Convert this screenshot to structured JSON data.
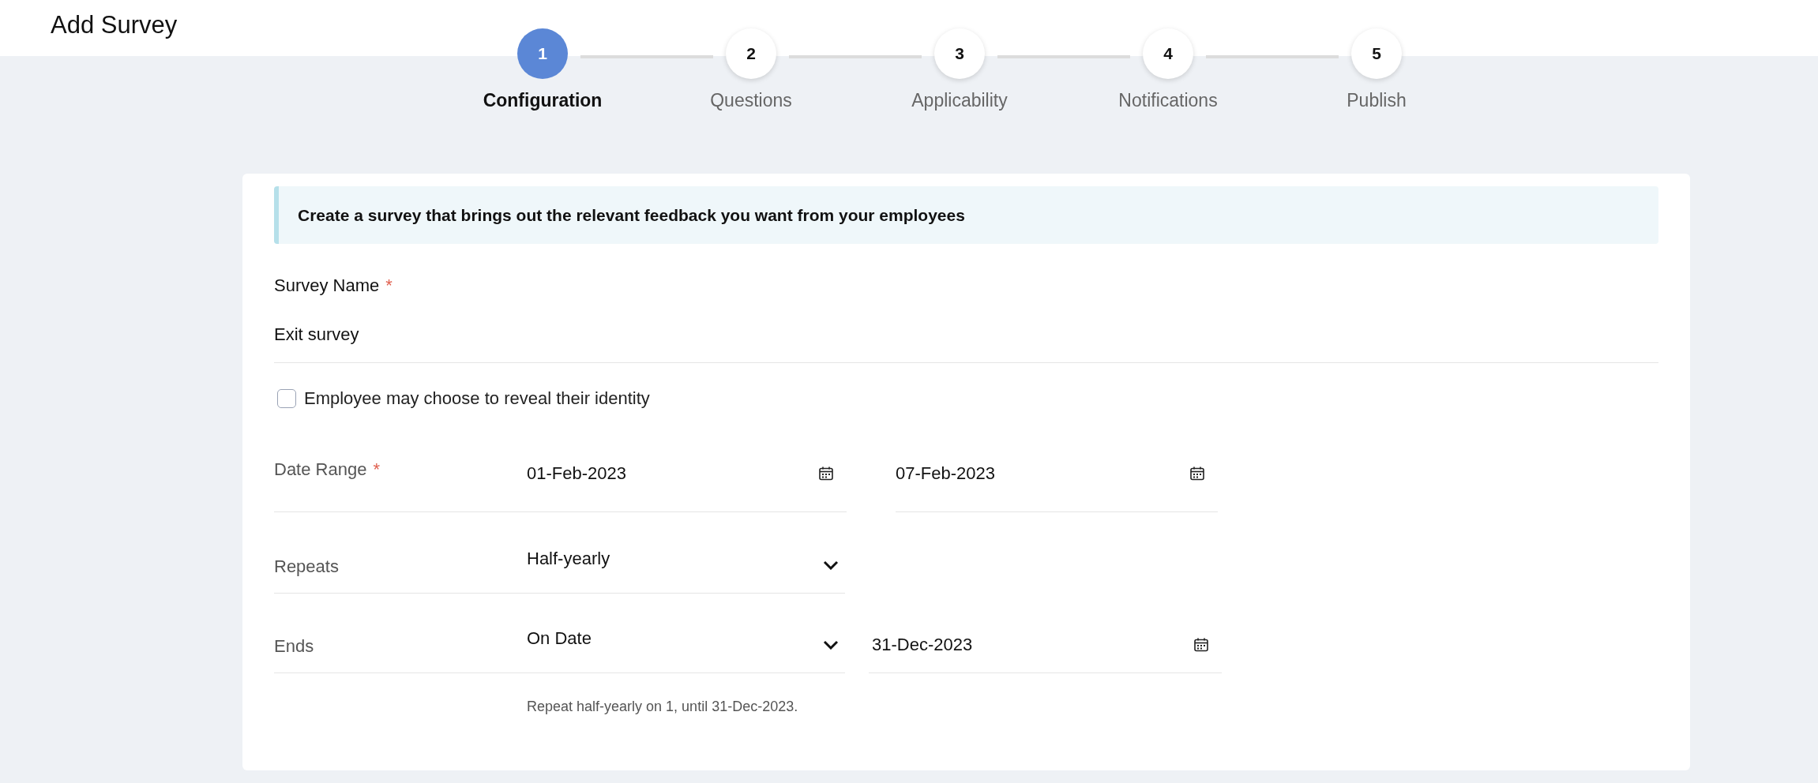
{
  "title": "Add Survey",
  "steps": [
    {
      "number": "1",
      "label": "Configuration",
      "selected": true
    },
    {
      "number": "2",
      "label": "Questions",
      "selected": false
    },
    {
      "number": "3",
      "label": "Applicability",
      "selected": false
    },
    {
      "number": "4",
      "label": "Notifications",
      "selected": false
    },
    {
      "number": "5",
      "label": "Publish",
      "selected": false
    }
  ],
  "banner": "Create a survey that brings out the relevant feedback you want from your employees",
  "survey_name": {
    "label": "Survey Name",
    "required_mark": "*",
    "value": "Exit survey"
  },
  "identity_checkbox": {
    "label": "Employee may choose to reveal their identity",
    "checked": false
  },
  "date_range": {
    "label": "Date Range",
    "required_mark": "*",
    "start": "01-Feb-2023",
    "end": "07-Feb-2023"
  },
  "repeats": {
    "label": "Repeats",
    "value": "Half-yearly"
  },
  "ends": {
    "label": "Ends",
    "value": "On Date",
    "date": "31-Dec-2023"
  },
  "hint": "Repeat half-yearly on 1, until 31-Dec-2023."
}
